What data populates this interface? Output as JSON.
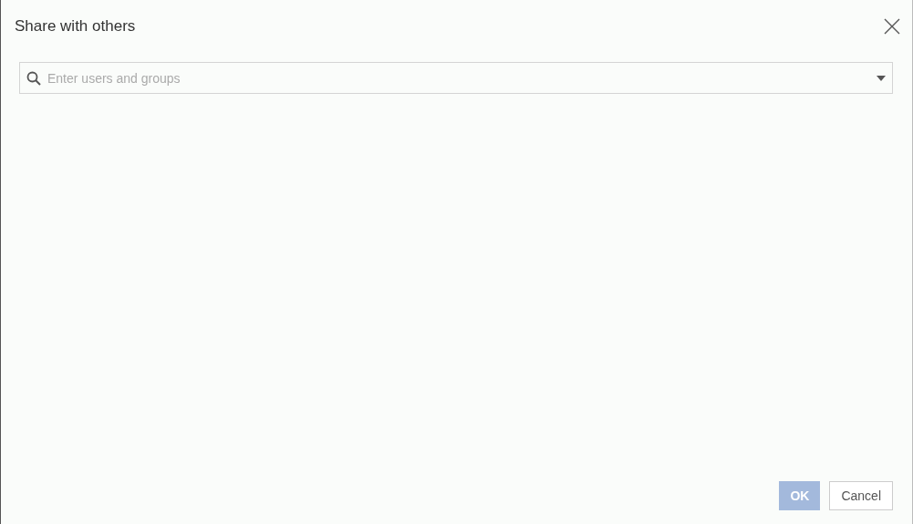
{
  "dialog": {
    "title": "Share with others"
  },
  "search": {
    "placeholder": "Enter users and groups"
  },
  "buttons": [
    {
      "label": "OK",
      "kind": "primary",
      "disabled": true
    },
    {
      "label": "Cancel",
      "kind": "secondary",
      "disabled": false
    }
  ]
}
